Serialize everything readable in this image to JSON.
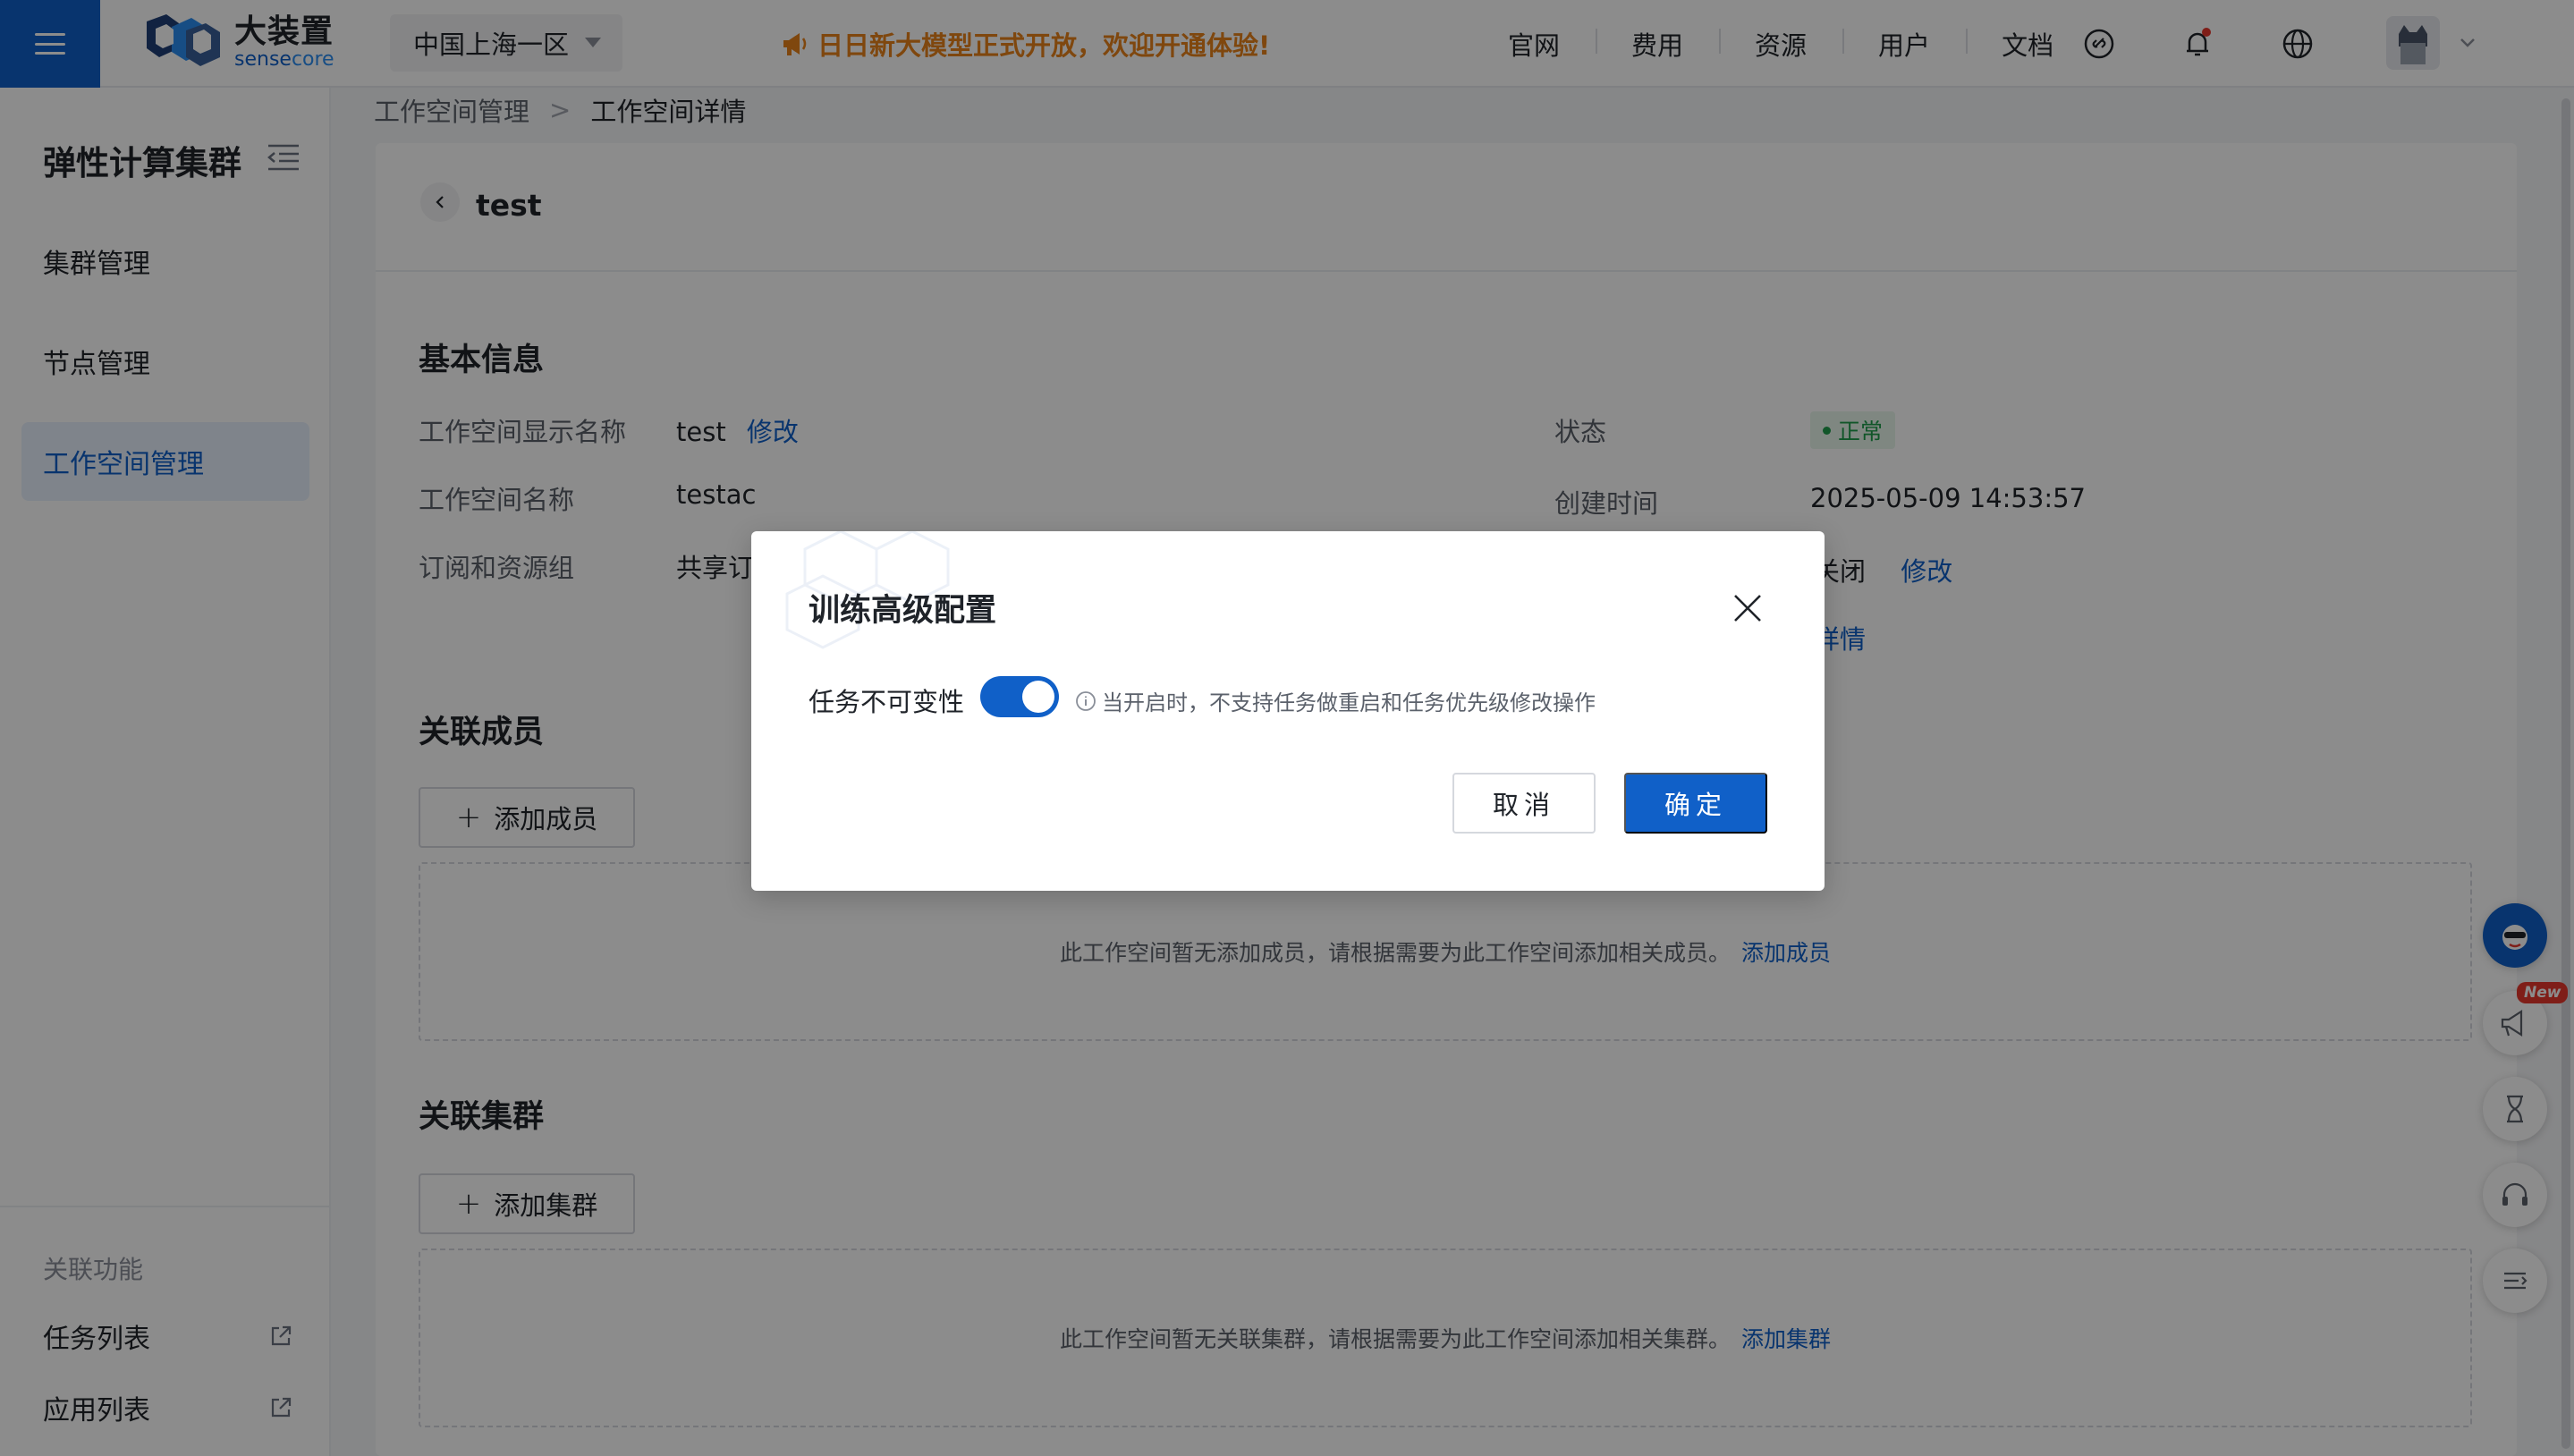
{
  "header": {
    "logo_title": "大装置",
    "logo_sub_a": "sense",
    "logo_sub_b": "core",
    "region": "中国上海一区",
    "announcement": "日日新大模型正式开放，欢迎开通体验!",
    "nav": [
      "官网",
      "费用",
      "资源",
      "用户",
      "文档"
    ],
    "icons": [
      "menu-icon",
      "link-icon",
      "bell-icon",
      "globe-icon",
      "avatar",
      "chevron-down-icon"
    ]
  },
  "sidebar": {
    "title": "弹性计算集群",
    "items": [
      "集群管理",
      "节点管理",
      "工作空间管理"
    ],
    "active_index": 2,
    "group_title": "关联功能",
    "links": [
      "任务列表",
      "应用列表"
    ]
  },
  "breadcrumb": {
    "parent": "工作空间管理",
    "separator": ">",
    "current": "工作空间详情"
  },
  "page": {
    "title": "test",
    "basic_info": {
      "section_title": "基本信息",
      "display_name_label": "工作空间显示名称",
      "display_name_value": "test",
      "modify_label": "修改",
      "name_label": "工作空间名称",
      "name_value": "testac",
      "subscription_label": "订阅和资源组",
      "subscription_value": "共享订",
      "status_label": "状态",
      "status_value": "正常",
      "created_label": "创建时间",
      "created_value": "2025-05-09 14:53:57",
      "partial_value_1": "关闭",
      "partial_modify": "修改",
      "partial_detail": "详情"
    },
    "members": {
      "section_title": "关联成员",
      "add_button": "添加成员",
      "empty_text": "此工作空间暂无添加成员，请根据需要为此工作空间添加相关成员。",
      "empty_link": "添加成员"
    },
    "clusters": {
      "section_title": "关联集群",
      "add_button": "添加集群",
      "empty_text": "此工作空间暂无关联集群，请根据需要为此工作空间添加相关集群。",
      "empty_link": "添加集群"
    }
  },
  "modal": {
    "title": "训练高级配置",
    "field_label": "任务不可变性",
    "toggle_on": true,
    "hint": "当开启时，不支持任务做重启和任务优先级修改操作",
    "cancel_label": "取消",
    "ok_label": "确定"
  },
  "floating": {
    "new_badge": "New",
    "icons": [
      "assistant-avatar-icon",
      "megaphone-icon",
      "hourglass-icon",
      "headset-icon",
      "collapse-list-icon"
    ]
  },
  "colors": {
    "primary": "#1060c8",
    "announce": "#e8821a",
    "success": "#1f9d4c",
    "danger": "#e8372c"
  }
}
